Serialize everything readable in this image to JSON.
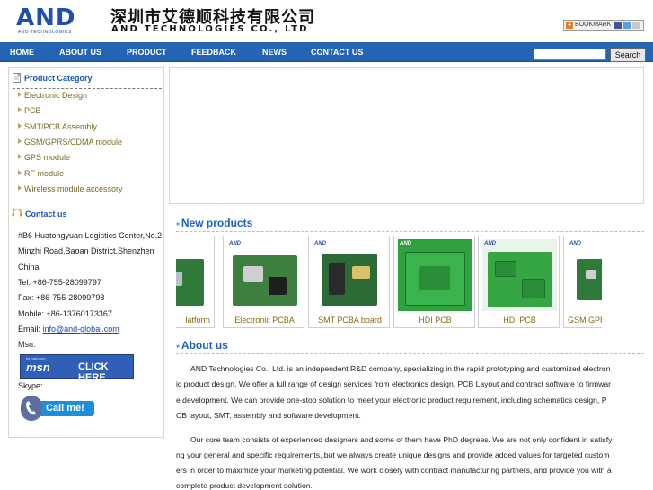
{
  "header": {
    "logo_text": "AND",
    "logo_sub": "AND TECHNOLOGIES",
    "company_cn": "深圳市艾德顺科技有限公司",
    "company_en": "AND TECHNOLOGIES CO., LTD",
    "bookmark_label": "BOOKMARK"
  },
  "nav": {
    "items": [
      "HOME",
      "ABOUT US",
      "PRODUCT",
      "FEEDBACK",
      "NEWS",
      "CONTACT US"
    ],
    "search_value": "",
    "search_button": "Search"
  },
  "sidebar": {
    "category_title": "Product Category",
    "categories": [
      "Electronic Design",
      "PCB",
      "SMT/PCB Assembly",
      "GSM/GPRS/CDMA module",
      "GPS module",
      "RF module",
      "Wireless module accessory"
    ],
    "contact_title": "Contact us",
    "address_1": "#B6 Huatongyuan Logistics Center,No.2",
    "address_2": "Minzhi Road,Baoan District,Shenzhen",
    "address_3": "China",
    "tel": "Tel: +86-755-28099797",
    "fax": "Fax: +86-755-28099798",
    "mobile": "Mobile: +86-13760173367",
    "email_label": "Email: ",
    "email_link": "info@and-global.com",
    "msn_label": "Msn:",
    "msn_badge_small": "im.msn.com",
    "msn_badge_left": "msn",
    "msn_badge_right": "CLICK HERE",
    "skype_label": "Skype:",
    "skype_button": "Call me!"
  },
  "new_products": {
    "title": "New products",
    "items": [
      {
        "caption": "latform"
      },
      {
        "caption": "Electronic PCBA"
      },
      {
        "caption": "SMT PCBA board"
      },
      {
        "caption": "HDI PCB"
      },
      {
        "caption": "HDI PCB"
      },
      {
        "caption": "GSM GPR"
      }
    ],
    "thumb_tag": "AND"
  },
  "about": {
    "title": "About us",
    "lines": [
      "AND Technologies Co., Ltd. is an independent R&D company, specializing in the rapid prototyping and customized electron",
      "ic product design. We offer a full range of design services from electronics design, PCB Layout and contract software to firmwar",
      "e development. We can provide one-stop solution to meet your electronic product requirement, including schematics design, P",
      "CB layout, SMT, assembly and software development.",
      "Our core team consists of experienced designers and some of them have PhD degrees. We are not only confident in satisfyi",
      "ng your general and specific requirements, but we always create unique designs and provide added values for targeted custom",
      "ers in order to maximize your marketing potential. We work closely with contract manufacturing partners, and provide you with a",
      "complete product development solution."
    ]
  },
  "colors": {
    "nav_bg": "#2563b3",
    "section_title": "#1a62c4",
    "category_text": "#7d6a23",
    "caption_text": "#8a6a14"
  }
}
